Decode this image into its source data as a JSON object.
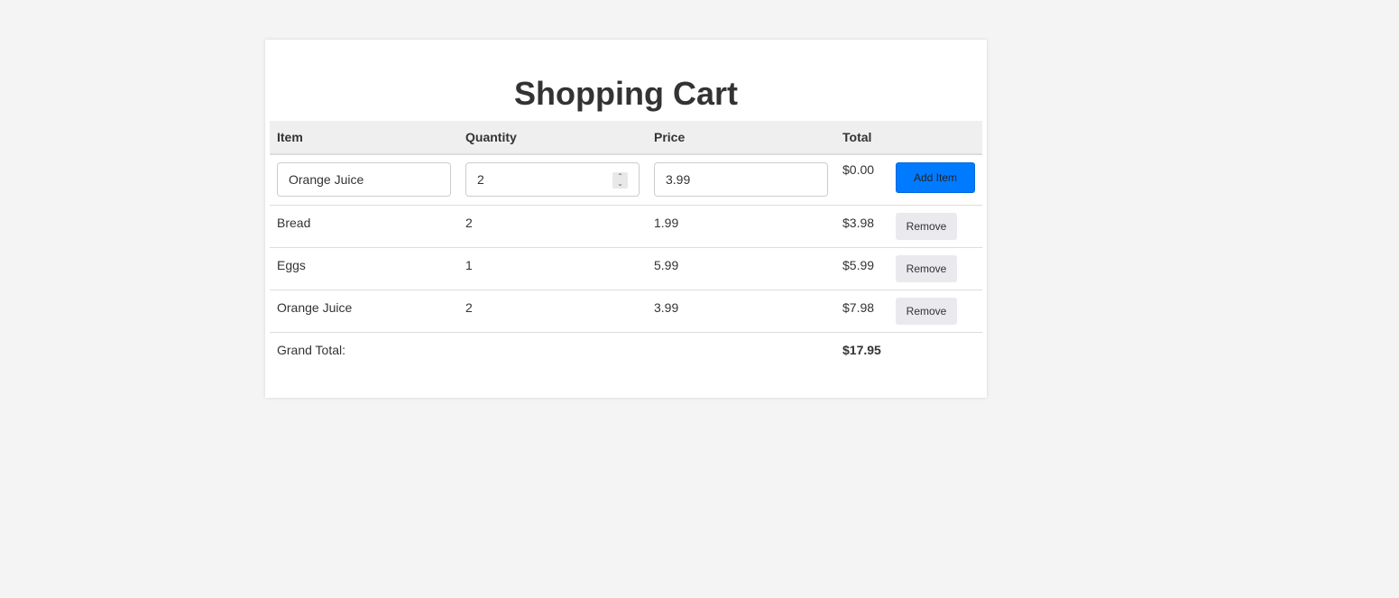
{
  "page": {
    "title": "Shopping Cart"
  },
  "table": {
    "headers": {
      "item": "Item",
      "quantity": "Quantity",
      "price": "Price",
      "total": "Total",
      "action": ""
    }
  },
  "new_item": {
    "name_value": "Orange Juice",
    "quantity_value": "2",
    "price_value": "3.99",
    "total": "$0.00",
    "add_label": "Add Item"
  },
  "items": [
    {
      "name": "Bread",
      "quantity": "2",
      "price": "1.99",
      "total": "$3.98",
      "remove_label": "Remove"
    },
    {
      "name": "Eggs",
      "quantity": "1",
      "price": "5.99",
      "total": "$5.99",
      "remove_label": "Remove"
    },
    {
      "name": "Orange Juice",
      "quantity": "2",
      "price": "3.99",
      "total": "$7.98",
      "remove_label": "Remove"
    }
  ],
  "grand_total": {
    "label": "Grand Total:",
    "value": "$17.95"
  },
  "colors": {
    "accent": "#007bff",
    "background": "#f4f4f4",
    "header_bg": "#efefef"
  }
}
